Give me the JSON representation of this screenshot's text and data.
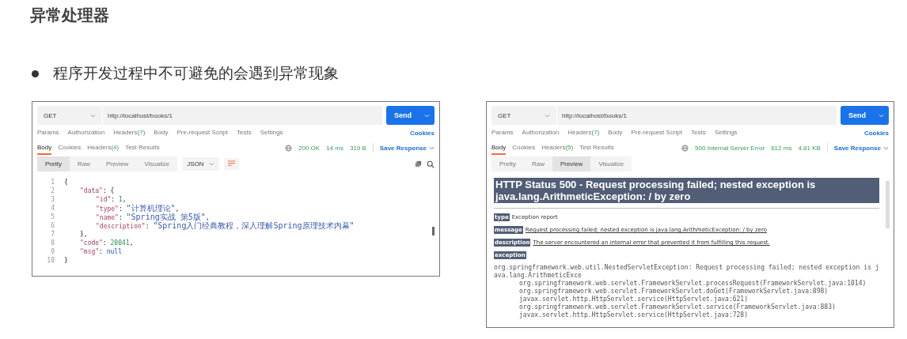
{
  "slide": {
    "title": "异常处理器",
    "bullet": "程序开发过程中不可避免的会遇到异常现象"
  },
  "panels": [
    {
      "kind": "json",
      "method": "GET",
      "url": "http://localhost/books/1",
      "send": "Send",
      "request_tabs": [
        {
          "label": "Params",
          "selected": false
        },
        {
          "label": "Authorization",
          "selected": false
        },
        {
          "label": "Headers",
          "count": "(7)",
          "selected": false
        },
        {
          "label": "Body",
          "selected": false
        },
        {
          "label": "Pre-request Script",
          "selected": false
        },
        {
          "label": "Tests",
          "selected": false
        },
        {
          "label": "Settings",
          "selected": false
        }
      ],
      "cookies": "Cookies",
      "response_tabs": [
        {
          "label": "Body",
          "selected": true
        },
        {
          "label": "Cookies",
          "selected": false
        },
        {
          "label": "Headers",
          "count": "(4)",
          "selected": false
        },
        {
          "label": "Test Results",
          "selected": false
        }
      ],
      "status": "200 OK",
      "time": "14 ms",
      "size": "319 B",
      "save_response": "Save Response",
      "view_tabs": [
        {
          "label": "Pretty",
          "selected": true
        },
        {
          "label": "Raw",
          "selected": false
        },
        {
          "label": "Preview",
          "selected": false
        },
        {
          "label": "Visualize",
          "selected": false
        }
      ],
      "format": "JSON",
      "code_lines": [
        {
          "number": "1",
          "tokens": [
            {
              "kind": "punct",
              "text": "{"
            }
          ],
          "children": [
            {
              "number": "2",
              "tokens": [
                {
                  "kind": "key",
                  "text": "\"data\""
                },
                {
                  "kind": "punct",
                  "text": ": {"
                }
              ],
              "children": [
                {
                  "number": "3",
                  "tokens": [
                    {
                      "kind": "key",
                      "text": "\"id\""
                    },
                    {
                      "kind": "punct",
                      "text": ": "
                    },
                    {
                      "kind": "number",
                      "text": "1"
                    },
                    {
                      "kind": "punct",
                      "text": ","
                    }
                  ]
                },
                {
                  "number": "4",
                  "tokens": [
                    {
                      "kind": "key",
                      "text": "\"type\""
                    },
                    {
                      "kind": "punct",
                      "text": ": "
                    },
                    {
                      "kind": "string",
                      "text": "\"计算机理论\""
                    },
                    {
                      "kind": "punct",
                      "text": ","
                    }
                  ]
                },
                {
                  "number": "5",
                  "tokens": [
                    {
                      "kind": "key",
                      "text": "\"name\""
                    },
                    {
                      "kind": "punct",
                      "text": ": "
                    },
                    {
                      "kind": "string",
                      "text": "\"Spring实战 第5版\""
                    },
                    {
                      "kind": "punct",
                      "text": ","
                    }
                  ]
                },
                {
                  "number": "6",
                  "tokens": [
                    {
                      "kind": "key",
                      "text": "\"description\""
                    },
                    {
                      "kind": "punct",
                      "text": ": "
                    },
                    {
                      "kind": "string",
                      "text": "\"Spring入门经典教程，深入理解Spring原理技术内幕\""
                    }
                  ]
                }
              ]
            },
            {
              "number": "7",
              "tokens": [
                {
                  "kind": "punct",
                  "text": "},"
                }
              ]
            },
            {
              "number": "8",
              "tokens": [
                {
                  "kind": "key",
                  "text": "\"code\""
                },
                {
                  "kind": "punct",
                  "text": ": "
                },
                {
                  "kind": "number",
                  "text": "20041"
                },
                {
                  "kind": "punct",
                  "text": ","
                }
              ]
            },
            {
              "number": "9",
              "tokens": [
                {
                  "kind": "key",
                  "text": "\"msg\""
                },
                {
                  "kind": "punct",
                  "text": ": "
                },
                {
                  "kind": "keyword",
                  "text": "null"
                }
              ]
            }
          ]
        },
        {
          "number": "10",
          "tokens": [
            {
              "kind": "punct",
              "text": "}"
            }
          ]
        }
      ]
    },
    {
      "kind": "html",
      "method": "GET",
      "url": "http://localhost/books/1",
      "send": "Send",
      "request_tabs": [
        {
          "label": "Params",
          "selected": false
        },
        {
          "label": "Authorization",
          "selected": false
        },
        {
          "label": "Headers",
          "count": "(7)",
          "selected": false
        },
        {
          "label": "Body",
          "selected": false
        },
        {
          "label": "Pre-request Script",
          "selected": false
        },
        {
          "label": "Tests",
          "selected": false
        },
        {
          "label": "Settings",
          "selected": false
        }
      ],
      "cookies": "Cookies",
      "response_tabs": [
        {
          "label": "Body",
          "selected": true
        },
        {
          "label": "Cookies",
          "selected": false
        },
        {
          "label": "Headers",
          "count": "(5)",
          "selected": false
        },
        {
          "label": "Test Results",
          "selected": false
        }
      ],
      "status": "500 Internal Server Error",
      "time": "612 ms",
      "size": "4.81 KB",
      "save_response": "Save Response",
      "view_tabs": [
        {
          "label": "Pretty",
          "selected": false
        },
        {
          "label": "Raw",
          "selected": false
        },
        {
          "label": "Preview",
          "selected": true
        },
        {
          "label": "Visualize",
          "selected": false
        }
      ],
      "html": {
        "heading": "HTTP Status 500 - Request processing failed; nested exception is java.lang.ArithmeticException: / by zero",
        "fields": [
          {
            "label": "type",
            "text": "Exception report",
            "underlined": false
          },
          {
            "label": "message",
            "text": "Request processing failed; nested exception is java.lang.ArithmeticException: / by zero",
            "underlined": true
          },
          {
            "label": "description",
            "text": "The server encountered an internal error that prevented it from fulfilling this request.",
            "underlined": true
          }
        ],
        "exception_label": "exception",
        "trace": {
          "line": "org.springframework.web.util.NestedServletException: Request processing failed; nested exception is java.lang.ArithmeticExce",
          "frames": [
            "org.springframework.web.servlet.FrameworkServlet.processRequest(FrameworkServlet.java:1014)",
            "org.springframework.web.servlet.FrameworkServlet.doGet(FrameworkServlet.java:898)",
            "javax.servlet.http.HttpServlet.service(HttpServlet.java:621)",
            "org.springframework.web.servlet.FrameworkServlet.service(FrameworkServlet.java:883)",
            "javax.servlet.http.HttpServlet.service(HttpServlet.java:728)"
          ]
        }
      }
    }
  ]
}
